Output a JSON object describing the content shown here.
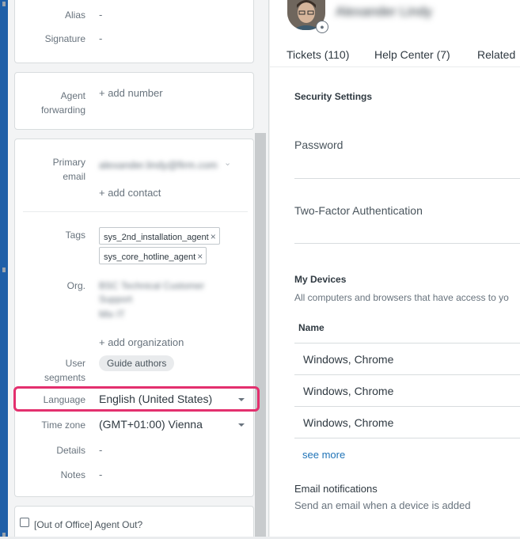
{
  "left": {
    "alias": {
      "label": "Alias",
      "value": "-"
    },
    "signature": {
      "label": "Signature",
      "value": "-"
    },
    "agent_forwarding": {
      "label_line1": "Agent",
      "label_line2": "forwarding",
      "action": "+ add number"
    },
    "primary_email": {
      "label_line1": "Primary",
      "label_line2": "email",
      "value": "alexander.lindy@firm.com",
      "add_contact": "+ add contact"
    },
    "tags": {
      "label": "Tags",
      "items": [
        "sys_2nd_installation_agent",
        "sys_core_hotline_agent"
      ],
      "remove_glyph": "×"
    },
    "org": {
      "label": "Org.",
      "line1": "BSC Technical Customer",
      "line2": "Support",
      "line3": "Mix IT",
      "add_organization": "+ add organization"
    },
    "user_segments": {
      "label_line1": "User",
      "label_line2": "segments",
      "value": "Guide authors"
    },
    "language": {
      "label": "Language",
      "value": "English (United States)"
    },
    "time_zone": {
      "label": "Time zone",
      "value": "(GMT+01:00) Vienna"
    },
    "details": {
      "label": "Details",
      "value": "-"
    },
    "notes": {
      "label": "Notes",
      "value": "-"
    },
    "out_of_office": {
      "label": "[Out of Office] Agent Out?",
      "checked": false
    },
    "highlight_color": "#e3306e"
  },
  "right": {
    "user_name": "Alexander Lindy",
    "tabs": [
      {
        "label": "Tickets (110)"
      },
      {
        "label": "Help Center (7)"
      },
      {
        "label": "Related"
      }
    ],
    "security_settings": "Security Settings",
    "password": "Password",
    "two_factor": "Two-Factor Authentication",
    "my_devices": "My Devices",
    "devices_desc": "All computers and browsers that have access to yo",
    "name_header": "Name",
    "devices": [
      "Windows, Chrome",
      "Windows, Chrome",
      "Windows, Chrome"
    ],
    "see_more": "see more",
    "email_notifications": "Email notifications",
    "email_notifications_desc": "Send an email when a device is added"
  }
}
